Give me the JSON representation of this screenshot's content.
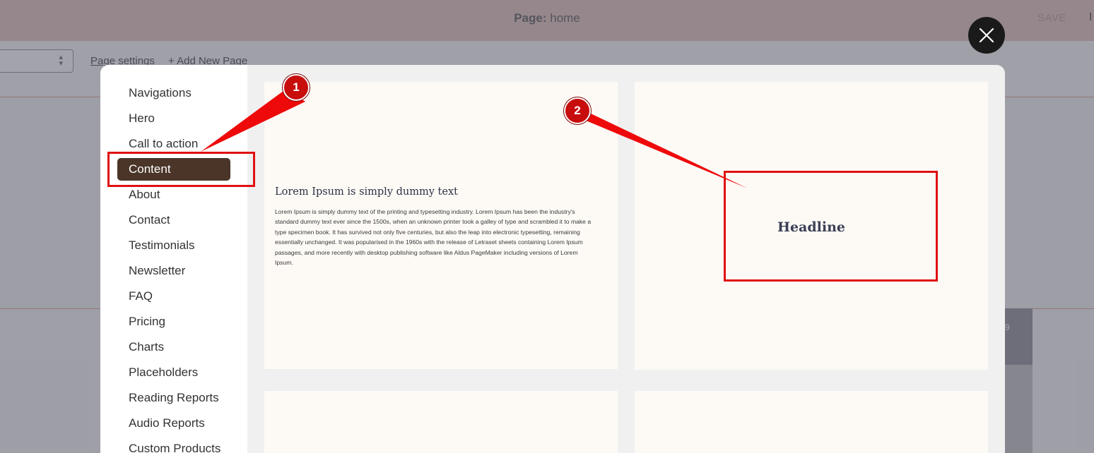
{
  "topbar": {
    "page_prefix": "Page:",
    "page_name": "home",
    "save_label": "SAVE",
    "trailing_char": "I"
  },
  "subbar": {
    "page_settings_link": "Page settings",
    "add_page_link": "+ Add New Page"
  },
  "preview_card": {
    "number": "9"
  },
  "modal": {
    "sidebar": {
      "items": [
        {
          "label": "Navigations"
        },
        {
          "label": "Hero"
        },
        {
          "label": "Call to action"
        },
        {
          "label": "Content",
          "active": true
        },
        {
          "label": "About"
        },
        {
          "label": "Contact"
        },
        {
          "label": "Testimonials"
        },
        {
          "label": "Newsletter"
        },
        {
          "label": "FAQ"
        },
        {
          "label": "Pricing"
        },
        {
          "label": "Charts"
        },
        {
          "label": "Placeholders"
        },
        {
          "label": "Reading Reports"
        },
        {
          "label": "Audio Reports"
        },
        {
          "label": "Custom Products"
        }
      ]
    },
    "templates": [
      {
        "title": "Lorem Ipsum is simply dummy text",
        "body": "Lorem Ipsum is simply dummy text of the printing and typesetting industry. Lorem Ipsum has been the industry's standard dummy text ever since the 1500s, when an unknown printer took a galley of type and scrambled it to make a type specimen book. It has survived not only five centuries, but also the leap into electronic typesetting, remaining essentially unchanged. It was popularised in the 1960s with the release of Letraset sheets containing Lorem Ipsum passages, and more recently with desktop publishing software like Aldus PageMaker including versions of Lorem Ipsum."
      },
      {
        "headline": "Headline"
      }
    ],
    "close_icon": "close-icon"
  },
  "annotations": {
    "badges": [
      "1",
      "2"
    ],
    "color": "#e01010"
  },
  "colors": {
    "topbar": "#e7c9c1",
    "active_item": "#4a3528",
    "card_bg": "#fdfaf6",
    "close_button": "#1a1a1a"
  }
}
